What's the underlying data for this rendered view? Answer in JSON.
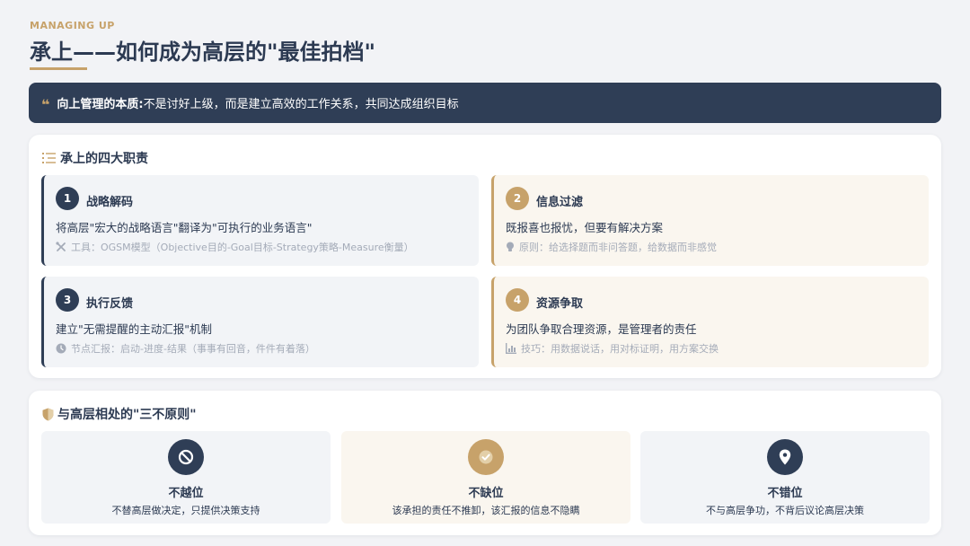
{
  "header": {
    "kicker": "MANAGING UP",
    "title": "承上——如何成为高层的\"最佳拍档\""
  },
  "banner": {
    "label": "向上管理的本质:",
    "text": " 不是讨好上级，而是建立高效的工作关系，共同达成组织目标"
  },
  "duties": {
    "heading": "承上的四大职责",
    "items": [
      {
        "num": "1",
        "title": "战略解码",
        "desc": "将高层\"宏大的战略语言\"翻译为\"可执行的业务语言\"",
        "note": "工具：OGSM模型（Objective目的-Goal目标-Strategy策略-Measure衡量）",
        "note_icon": "tools-icon"
      },
      {
        "num": "2",
        "title": "信息过滤",
        "desc": "既报喜也报忧，但要有解决方案",
        "note": "原则：给选择题而非问答题，给数据而非感觉",
        "note_icon": "lightbulb-icon"
      },
      {
        "num": "3",
        "title": "执行反馈",
        "desc": "建立\"无需提醒的主动汇报\"机制",
        "note": "节点汇报：启动-进度-结果（事事有回音，件件有着落）",
        "note_icon": "clock-icon"
      },
      {
        "num": "4",
        "title": "资源争取",
        "desc": "为团队争取合理资源，是管理者的责任",
        "note": "技巧：用数据说话，用对标证明，用方案交换",
        "note_icon": "chart-icon"
      }
    ]
  },
  "principles": {
    "heading": "与高层相处的\"三不原则\"",
    "items": [
      {
        "title": "不越位",
        "desc": "不替高层做决定，只提供决策支持",
        "icon": "ban-icon"
      },
      {
        "title": "不缺位",
        "desc": "该承担的责任不推卸，该汇报的信息不隐瞒",
        "icon": "check-circle-icon"
      },
      {
        "title": "不错位",
        "desc": "不与高层争功，不背后议论高层决策",
        "icon": "map-pin-icon"
      }
    ]
  },
  "colors": {
    "navy": "#2f3e56",
    "gold": "#c7a26a",
    "cream": "#faf6ef",
    "grey_panel": "#f2f4f7",
    "background": "#f2f3f6"
  }
}
